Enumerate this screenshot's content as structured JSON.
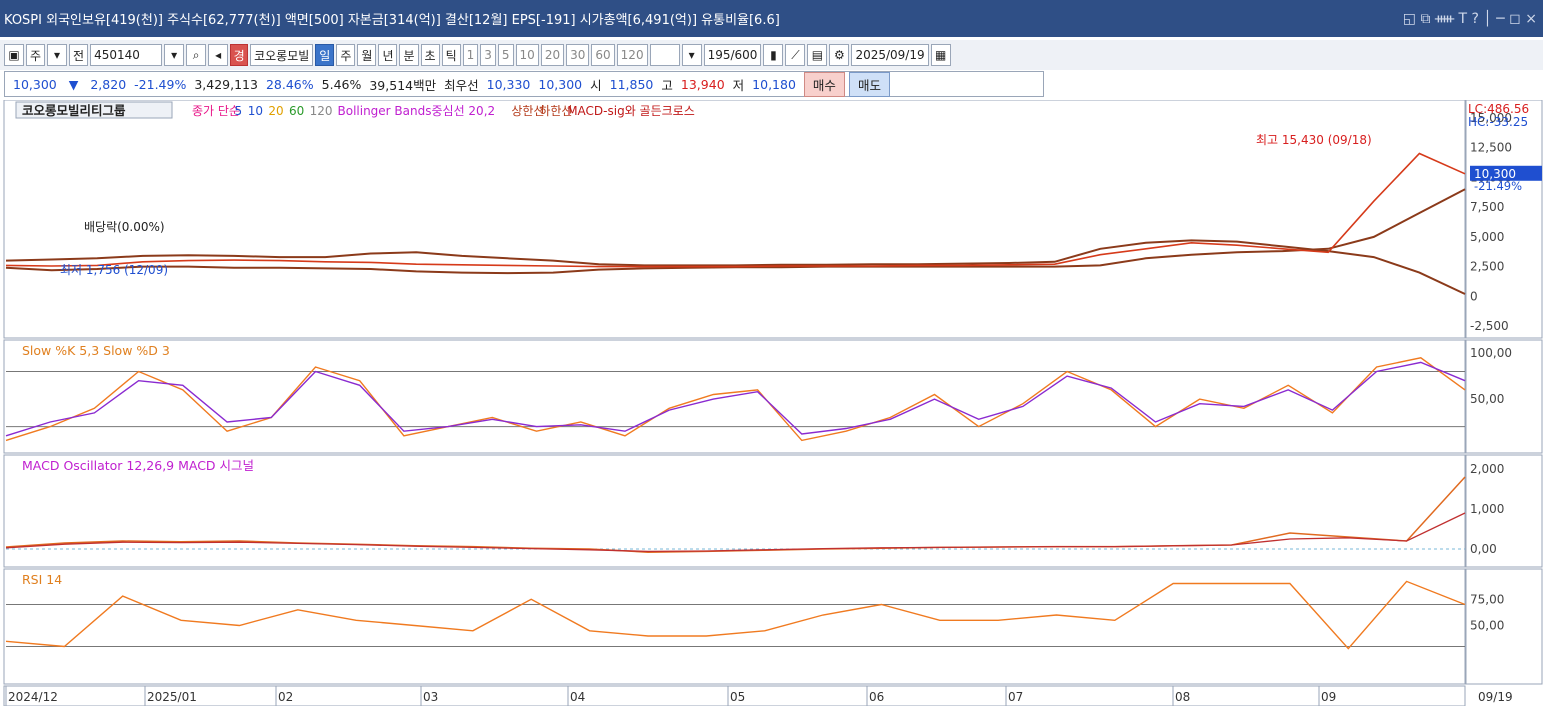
{
  "titlebar": {
    "text": "KOSPI 외국인보유[419(천)] 주식수[62,777(천)] 액면[500] 자본금[314(억)] 결산[12월] EPS[-191] 시가총액[6,491(억)] 유통비율[6.6]",
    "buttons": "◱ ⧉ ᚔ T ? │ ─ ◻ ×"
  },
  "toolbar": {
    "week_label": "주",
    "prev_label": "전",
    "code": "450140",
    "warn_label": "경",
    "stock_name": "코오롱모빌",
    "periods": [
      "일",
      "주",
      "월",
      "년",
      "분",
      "초",
      "틱"
    ],
    "active_period": "일",
    "intervals": [
      "1",
      "3",
      "5",
      "10",
      "20",
      "30",
      "60",
      "120"
    ],
    "count": "195",
    "count_total": "/600",
    "date": "2025/09/19"
  },
  "infobar": {
    "price": "10,300",
    "change_arrow": "▼",
    "change": "2,820",
    "change_pct": "-21.49%",
    "volume": "3,429,113",
    "vol_ratio": "28.46%",
    "turnover": "5.46%",
    "amount": "39,514백만",
    "best_ask_label": "최우선",
    "best_ask": "10,330",
    "best_bid": "10,300",
    "open_label": "시",
    "open": "11,850",
    "high_label": "고",
    "high": "13,940",
    "low_label": "저",
    "low": "10,180",
    "buy_label": "매수",
    "sell_label": "매도"
  },
  "chart_data": [
    {
      "type": "line",
      "title": "코오롱모빌리티그룹",
      "legend": [
        "종가 단순",
        "5",
        "10",
        "20",
        "60",
        "120",
        "Bollinger Bands중심선 20,2",
        "상한선",
        "하한선",
        "MACD-sig와 골든크로스"
      ],
      "y_ticks": [
        "15,000",
        "12,500",
        "10,000",
        "7,500",
        "5,000",
        "2,500",
        "0",
        "-2,500"
      ],
      "current_price": "10,300",
      "current_pct": "-21.49%",
      "lc_label": "LC:486.56",
      "hc_label": "HC:-33.25",
      "annotations": {
        "high_label": "최고 15,430 (09/18)",
        "low_label": "최저 1,756 (12/09)",
        "dividend_label": "배당락(0.00%)"
      },
      "series": [
        {
          "values": [
            2600,
            2550,
            2600,
            2900,
            3000,
            3050,
            3000,
            2900,
            2850,
            2700,
            2650,
            2600,
            2550,
            2500,
            2500,
            2500,
            2500,
            2550,
            2550,
            2550,
            2600,
            2600,
            2650,
            2700,
            3500,
            4000,
            4500,
            4300,
            4000,
            3700,
            8000,
            12000,
            10300
          ]
        },
        {
          "values": [
            3000,
            3100,
            3200,
            3400,
            3450,
            3400,
            3300,
            3300,
            3600,
            3700,
            3400,
            3200,
            3000,
            2700,
            2600,
            2600,
            2600,
            2650,
            2650,
            2700,
            2700,
            2750,
            2800,
            2900,
            4000,
            4500,
            4700,
            4600,
            4200,
            3800,
            3300,
            2000,
            200
          ]
        },
        {
          "values": [
            2400,
            2200,
            2300,
            2500,
            2500,
            2400,
            2400,
            2350,
            2300,
            2100,
            2000,
            1950,
            2000,
            2250,
            2350,
            2400,
            2450,
            2450,
            2500,
            2500,
            2500,
            2500,
            2500,
            2500,
            2600,
            3200,
            3500,
            3700,
            3800,
            4000,
            5000,
            7000,
            9000
          ]
        }
      ]
    },
    {
      "type": "line",
      "title": "Slow %K 5,3  Slow %D 3",
      "y_ticks": [
        "100,00",
        "50,00"
      ],
      "series": [
        {
          "name": "Slow %K",
          "values": [
            5,
            20,
            40,
            80,
            60,
            15,
            30,
            85,
            70,
            10,
            20,
            30,
            15,
            25,
            10,
            40,
            55,
            60,
            5,
            15,
            30,
            55,
            20,
            45,
            80,
            60,
            20,
            50,
            40,
            65,
            35,
            85,
            95,
            60
          ]
        },
        {
          "name": "Slow %D",
          "values": [
            10,
            25,
            35,
            70,
            65,
            25,
            30,
            80,
            65,
            15,
            20,
            28,
            20,
            22,
            15,
            38,
            50,
            58,
            12,
            18,
            28,
            50,
            28,
            42,
            75,
            62,
            25,
            45,
            42,
            60,
            38,
            80,
            90,
            70
          ]
        }
      ]
    },
    {
      "type": "line",
      "title": "MACD Oscillator 12,26,9  MACD  시그널",
      "y_ticks": [
        "2,000",
        "1,000",
        "0,00"
      ],
      "series": [
        {
          "name": "MACD",
          "values": [
            50,
            150,
            200,
            180,
            200,
            150,
            120,
            80,
            60,
            20,
            0,
            -80,
            -60,
            -30,
            0,
            20,
            40,
            50,
            60,
            60,
            80,
            100,
            400,
            300,
            200,
            1800
          ]
        },
        {
          "name": "시그널",
          "values": [
            30,
            120,
            170,
            160,
            170,
            140,
            110,
            70,
            40,
            10,
            -20,
            -60,
            -50,
            -20,
            10,
            30,
            40,
            50,
            60,
            60,
            80,
            100,
            250,
            280,
            200,
            900
          ]
        }
      ]
    },
    {
      "type": "area",
      "title": "RSI 14",
      "y_ticks": [
        "75,00",
        "50,00"
      ],
      "series": [
        {
          "values": [
            35,
            30,
            78,
            55,
            50,
            65,
            55,
            50,
            45,
            75,
            45,
            40,
            40,
            45,
            60,
            70,
            55,
            55,
            60,
            55,
            90,
            90,
            90,
            28,
            92,
            70
          ]
        }
      ]
    }
  ],
  "x_axis": [
    "2024/12",
    "2025/01",
    "02",
    "03",
    "04",
    "05",
    "06",
    "07",
    "08",
    "09"
  ],
  "x_axis_end": "09/19"
}
